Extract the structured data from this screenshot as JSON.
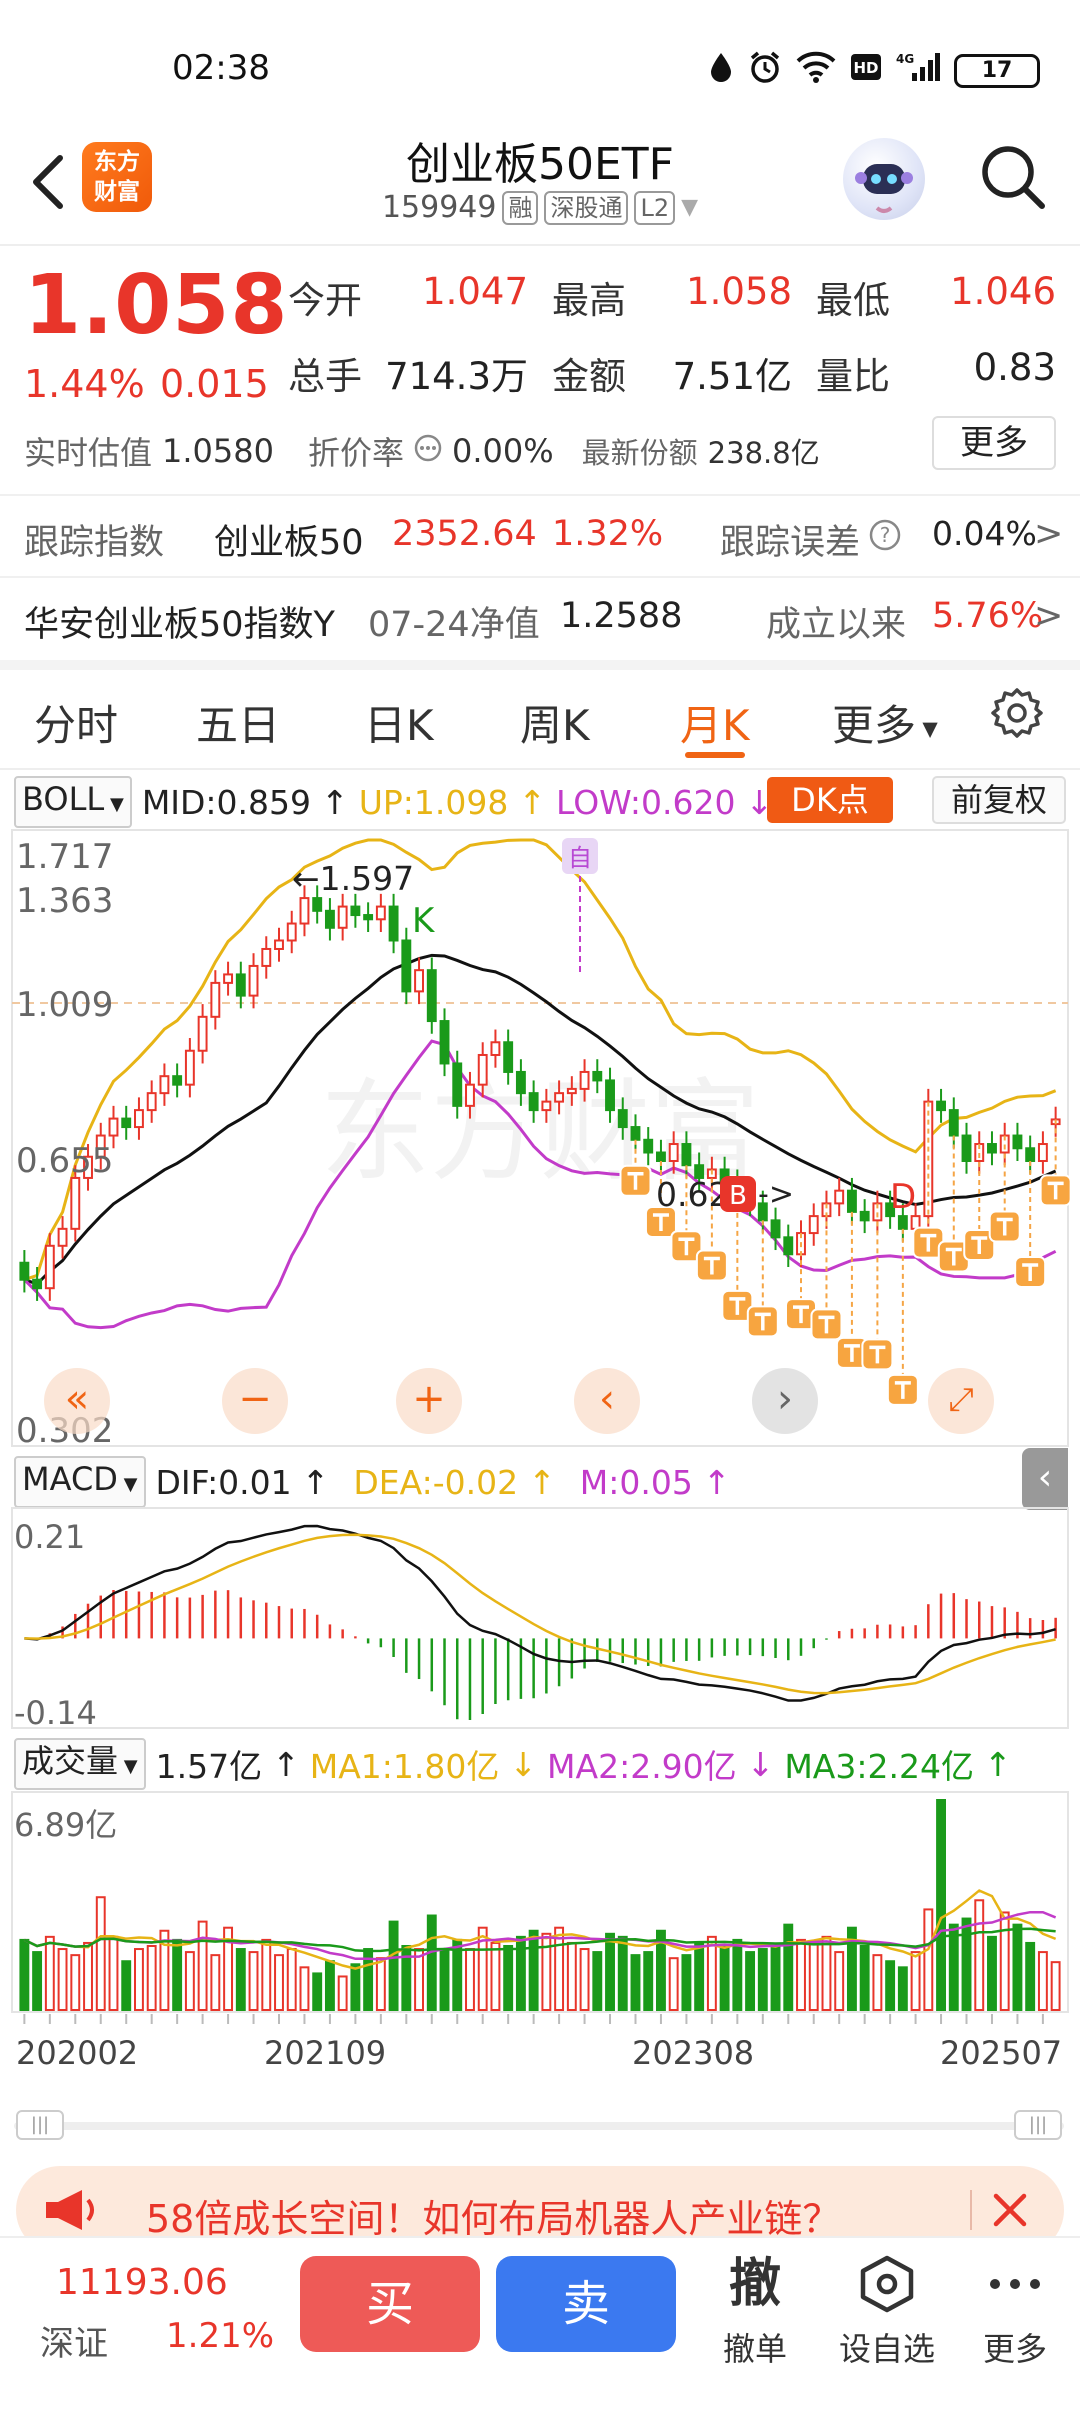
{
  "status_bar": {
    "time": "02:38",
    "battery": "17"
  },
  "header": {
    "logo_text_1": "东方",
    "logo_text_2": "财富",
    "title": "创业板50ETF",
    "code": "159949",
    "tag_margin": "融",
    "tag_connect": "深股通",
    "tag_level": "L2"
  },
  "quote": {
    "price": "1.058",
    "change_pct": "1.44%",
    "change_abs": "0.015",
    "fields": [
      {
        "label": "今开",
        "value": "1.047",
        "color": "red"
      },
      {
        "label": "最高",
        "value": "1.058",
        "color": "red"
      },
      {
        "label": "最低",
        "value": "1.046",
        "color": "red"
      },
      {
        "label": "总手",
        "value": "714.3万",
        "color": "black"
      },
      {
        "label": "金额",
        "value": "7.51亿",
        "color": "black"
      },
      {
        "label": "量比",
        "value": "0.83",
        "color": "black"
      }
    ],
    "est_label": "实时估值",
    "est_value": "1.0580",
    "premium_label": "折价率",
    "premium_value": "0.00%",
    "shares_label": "最新份额",
    "shares_value": "238.8亿",
    "more_label": "更多"
  },
  "tracking": {
    "label": "跟踪指数",
    "index_name": "创业板50",
    "index_value": "2352.64",
    "index_pct": "1.32%",
    "error_label": "跟踪误差",
    "error_value": "0.04%",
    "arrow": ">"
  },
  "nav": {
    "fund_name": "华安创业板50指数Y",
    "nav_label": "07-24净值",
    "nav_value": "1.2588",
    "since_label": "成立以来",
    "since_value": "5.76%",
    "arrow": ">"
  },
  "tabs": [
    "分时",
    "五日",
    "日K",
    "周K",
    "月K",
    "更多"
  ],
  "active_tab": "月K",
  "boll": {
    "selector": "BOLL",
    "mid": "MID:0.859",
    "up": "UP:1.098",
    "low": "LOW:0.620",
    "dk_label": "DK点",
    "fq_label": "前复权",
    "y_labels": [
      "1.717",
      "1.363",
      "1.009",
      "0.655",
      "0.302"
    ],
    "annotation_high": "←1.597",
    "annotation_low": "0.62",
    "annotation_arrow": "->",
    "mark_k": "K",
    "mark_d": "D",
    "mark_b": "B",
    "mark_self": "自",
    "watermark": "东方财富"
  },
  "macd": {
    "selector": "MACD",
    "dif": "DIF:0.01",
    "dea": "DEA:-0.02",
    "m": "M:0.05",
    "y_top": "0.21",
    "y_bottom": "-0.14"
  },
  "volume": {
    "selector": "成交量",
    "value": "1.57亿",
    "ma1": "MA1:1.80亿",
    "ma2": "MA2:2.90亿",
    "ma3": "MA3:2.24亿",
    "y_top": "6.89亿",
    "x_labels": [
      "202002",
      "202109",
      "202308",
      "202507"
    ]
  },
  "chart_data": {
    "type": "candlestick",
    "period": "monthly",
    "x_labels": [
      "202002",
      "202109",
      "202308",
      "202507"
    ],
    "ylim": [
      0.302,
      1.717
    ],
    "highlights": {
      "high": 1.597,
      "low": 0.62
    },
    "boll": {
      "mid": 0.859,
      "up": 1.098,
      "low": 0.62
    },
    "macd": {
      "dif": 0.01,
      "dea": -0.02,
      "m": 0.05,
      "ylim": [
        -0.14,
        0.21
      ]
    },
    "volume": {
      "last": "1.57亿",
      "ma1": "1.80亿",
      "ma2": "2.90亿",
      "ma3": "2.24亿",
      "ymax": "6.89亿"
    },
    "close": [
      0.68,
      0.66,
      0.76,
      0.8,
      0.92,
      0.97,
      1.02,
      1.06,
      1.04,
      1.08,
      1.12,
      1.16,
      1.14,
      1.22,
      1.3,
      1.38,
      1.4,
      1.35,
      1.42,
      1.46,
      1.48,
      1.52,
      1.58,
      1.55,
      1.51,
      1.56,
      1.54,
      1.53,
      1.56,
      1.48,
      1.36,
      1.41,
      1.29,
      1.19,
      1.09,
      1.14,
      1.21,
      1.24,
      1.17,
      1.12,
      1.08,
      1.1,
      1.12,
      1.13,
      1.17,
      1.15,
      1.08,
      1.04,
      1.01,
      0.98,
      0.96,
      1.0,
      0.95,
      0.92,
      0.94,
      0.91,
      0.88,
      0.86,
      0.82,
      0.78,
      0.74,
      0.79,
      0.83,
      0.86,
      0.89,
      0.84,
      0.82,
      0.86,
      0.83,
      0.8,
      0.83,
      1.1,
      1.08,
      1.02,
      0.96,
      1.0,
      0.98,
      1.02,
      0.99,
      0.96,
      1.0,
      1.058
    ],
    "open": [
      0.72,
      0.68,
      0.66,
      0.76,
      0.8,
      0.92,
      0.97,
      1.02,
      1.06,
      1.04,
      1.08,
      1.12,
      1.16,
      1.14,
      1.22,
      1.3,
      1.38,
      1.4,
      1.35,
      1.42,
      1.46,
      1.48,
      1.52,
      1.58,
      1.55,
      1.51,
      1.56,
      1.54,
      1.53,
      1.56,
      1.48,
      1.36,
      1.41,
      1.29,
      1.19,
      1.09,
      1.14,
      1.21,
      1.24,
      1.17,
      1.12,
      1.08,
      1.1,
      1.12,
      1.13,
      1.17,
      1.15,
      1.08,
      1.04,
      1.01,
      0.98,
      0.96,
      1.0,
      0.95,
      0.92,
      0.94,
      0.91,
      0.88,
      0.86,
      0.82,
      0.78,
      0.74,
      0.79,
      0.83,
      0.86,
      0.89,
      0.84,
      0.82,
      0.86,
      0.83,
      0.8,
      0.83,
      1.1,
      1.08,
      1.02,
      0.96,
      1.0,
      0.98,
      1.02,
      0.99,
      0.96,
      1.047
    ],
    "volume_values": [
      2.3,
      1.9,
      2.4,
      2.0,
      1.8,
      2.2,
      3.7,
      2.4,
      1.6,
      2.0,
      2.1,
      2.6,
      2.3,
      1.9,
      2.9,
      1.8,
      2.7,
      2.0,
      1.9,
      2.3,
      1.8,
      2.0,
      1.4,
      1.2,
      1.6,
      1.1,
      1.5,
      2.0,
      1.7,
      2.9,
      2.1,
      2.0,
      3.1,
      2.0,
      2.3,
      2.0,
      2.7,
      2.2,
      2.1,
      2.4,
      2.6,
      2.5,
      2.7,
      2.2,
      2.0,
      1.9,
      2.5,
      2.4,
      1.8,
      1.9,
      2.6,
      1.7,
      1.8,
      2.2,
      2.4,
      2.1,
      2.3,
      1.9,
      2.0,
      2.1,
      2.8,
      2.3,
      2.2,
      2.4,
      1.9,
      2.7,
      2.1,
      1.8,
      1.6,
      1.4,
      1.9,
      3.3,
      6.89,
      2.8,
      3.0,
      3.6,
      2.4,
      3.2,
      2.8,
      2.2,
      1.9,
      1.57
    ]
  },
  "ad": {
    "text": "58倍成长空间！如何布局机器人产业链？"
  },
  "bottom": {
    "index_value": "11193.06",
    "index_name": "深证",
    "index_pct": "1.21%",
    "buy": "买",
    "sell": "卖",
    "cancel_icon": "撤",
    "cancel": "撤单",
    "watchlist": "设自选",
    "more": "更多"
  },
  "colors": {
    "up": "#e8352a",
    "down": "#1a9a1a",
    "accent": "#f06414",
    "boll_mid": "#111111",
    "boll_up": "#e7b416",
    "boll_low": "#c23bc9"
  }
}
